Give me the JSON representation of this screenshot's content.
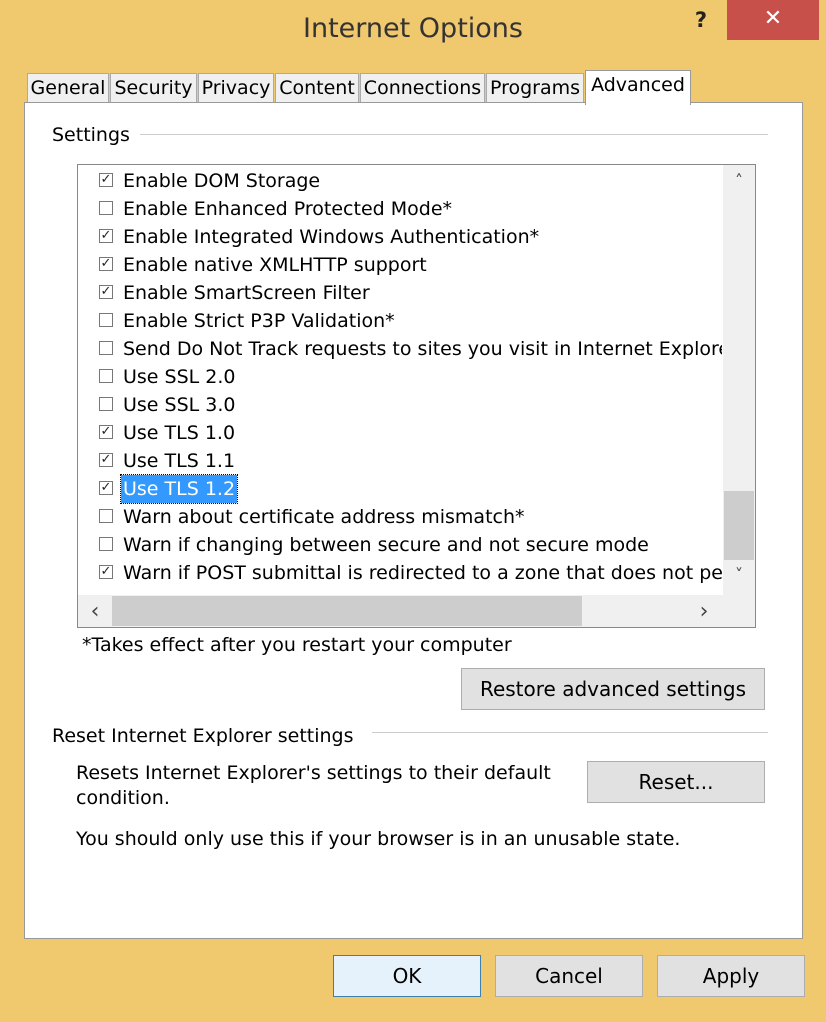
{
  "window": {
    "title": "Internet Options",
    "help_glyph": "?",
    "close_glyph": "✕"
  },
  "tabs": [
    {
      "label": "General"
    },
    {
      "label": "Security"
    },
    {
      "label": "Privacy"
    },
    {
      "label": "Content"
    },
    {
      "label": "Connections"
    },
    {
      "label": "Programs"
    },
    {
      "label": "Advanced",
      "active": true
    }
  ],
  "settings": {
    "label": "Settings",
    "items": [
      {
        "label": "Enable DOM Storage",
        "checked": true
      },
      {
        "label": "Enable Enhanced Protected Mode*",
        "checked": false
      },
      {
        "label": "Enable Integrated Windows Authentication*",
        "checked": true
      },
      {
        "label": "Enable native XMLHTTP support",
        "checked": true
      },
      {
        "label": "Enable SmartScreen Filter",
        "checked": true
      },
      {
        "label": "Enable Strict P3P Validation*",
        "checked": false
      },
      {
        "label": "Send Do Not Track requests to sites you visit in Internet Explorer",
        "checked": false
      },
      {
        "label": "Use SSL 2.0",
        "checked": false
      },
      {
        "label": "Use SSL 3.0",
        "checked": false
      },
      {
        "label": "Use TLS 1.0",
        "checked": true
      },
      {
        "label": "Use TLS 1.1",
        "checked": true
      },
      {
        "label": "Use TLS 1.2",
        "checked": true,
        "selected": true
      },
      {
        "label": "Warn about certificate address mismatch*",
        "checked": false
      },
      {
        "label": "Warn if changing between secure and not secure mode",
        "checked": false
      },
      {
        "label": "Warn if POST submittal is redirected to a zone that does not permit posts",
        "checked": true
      }
    ],
    "scroll_up": "˄",
    "scroll_down": "˅",
    "scroll_left": "‹",
    "scroll_right": "›",
    "restart_note": "*Takes effect after you restart your computer",
    "restore_button": "Restore advanced settings"
  },
  "reset": {
    "label": "Reset Internet Explorer settings",
    "description_line1": "Resets Internet Explorer's settings to their default",
    "description_line2": "condition.",
    "reset_button": "Reset...",
    "warning": "You should only use this if your browser is in an unusable state."
  },
  "footer": {
    "ok": "OK",
    "cancel": "Cancel",
    "apply": "Apply"
  },
  "colors": {
    "frame": "#f0c86e",
    "close": "#c7504a",
    "selection": "#3399ff"
  }
}
